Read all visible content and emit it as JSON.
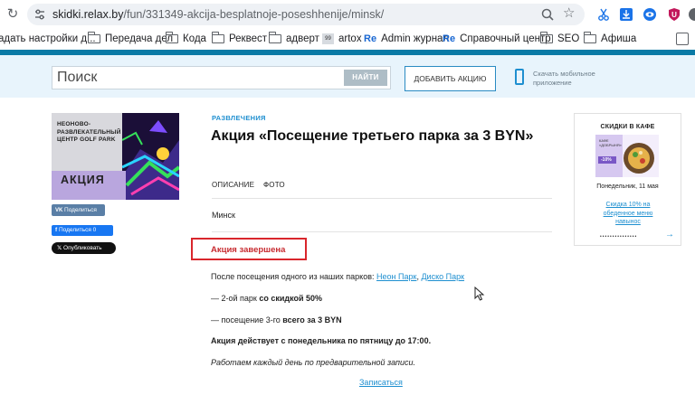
{
  "browser": {
    "url_host": "skidki.relax.by",
    "url_path": "/fun/331349-akcija-besplatnoje-poseshhenije/minsk/",
    "bookmarks": [
      {
        "label": "адать настройки д...",
        "icon": "page-icon"
      },
      {
        "label": "Передача дел",
        "icon": "folder-icon"
      },
      {
        "label": "Кода",
        "icon": "folder-icon"
      },
      {
        "label": "Реквест",
        "icon": "folder-icon"
      },
      {
        "label": "адверт",
        "icon": "folder-icon"
      },
      {
        "label": "artox",
        "icon": "artox-icon",
        "prefix": "99"
      },
      {
        "label": "Admin журнал",
        "icon": "re-icon",
        "prefix": "Re"
      },
      {
        "label": "Справочный центр",
        "icon": "re-icon",
        "prefix": "Re"
      },
      {
        "label": "SEO",
        "icon": "folder-icon"
      },
      {
        "label": "Афиша",
        "icon": "folder-icon"
      }
    ]
  },
  "header": {
    "search_placeholder": "Поиск",
    "search_button": "НАЙТИ",
    "add_button": "ДОБАВИТЬ АКЦИЮ",
    "app_text": "Скачать мобильное приложение"
  },
  "promo": {
    "image_title": "НЕОНОВО-РАЗВЛЕКАТЕЛЬНЫЙ ЦЕНТР GOLF PARK",
    "image_badge": "АКЦИЯ"
  },
  "share": {
    "vk": "Поделиться",
    "fb": "Поделиться 0",
    "x": "Опубликовать"
  },
  "article": {
    "category": "РАЗВЛЕЧЕНИЯ",
    "title": "Акция «Посещение третьего парка за 3 BYN»",
    "tabs": [
      "ОПИСАНИЕ",
      "ФОТО"
    ],
    "city": "Минск",
    "status": "Акция завершена",
    "intro": "После посещения одного из наших парков:",
    "park_links": [
      "Неон Парк",
      "Диско Парк"
    ],
    "line2_pre": "— 2-ой парк ",
    "line2_bold": "со скидкой 50%",
    "line3_pre": "— посещение 3-го ",
    "line3_bold": "всего за 3 BYN",
    "schedule": "Акция действует с понедельника по пятницу до 17:00.",
    "note": "Работаем каждый день по предварительной записи.",
    "subscribe": "Записаться"
  },
  "sidebar_widget": {
    "title": "СКИДКИ В КАФЕ",
    "img_badge": "-10%",
    "img_label": "КАФЕ «ДОБРЫНЯ»",
    "date": "Понедельник, 11 мая",
    "link": "Скидка 10% на обеденное меню навынос",
    "dots": "•••••••••••••••",
    "arrow": "→"
  },
  "colors": {
    "accent": "#1e8fd0",
    "status_red": "#c72a2f",
    "header_bg": "#e8f4fc",
    "promo_badge": "#b9a6de"
  }
}
